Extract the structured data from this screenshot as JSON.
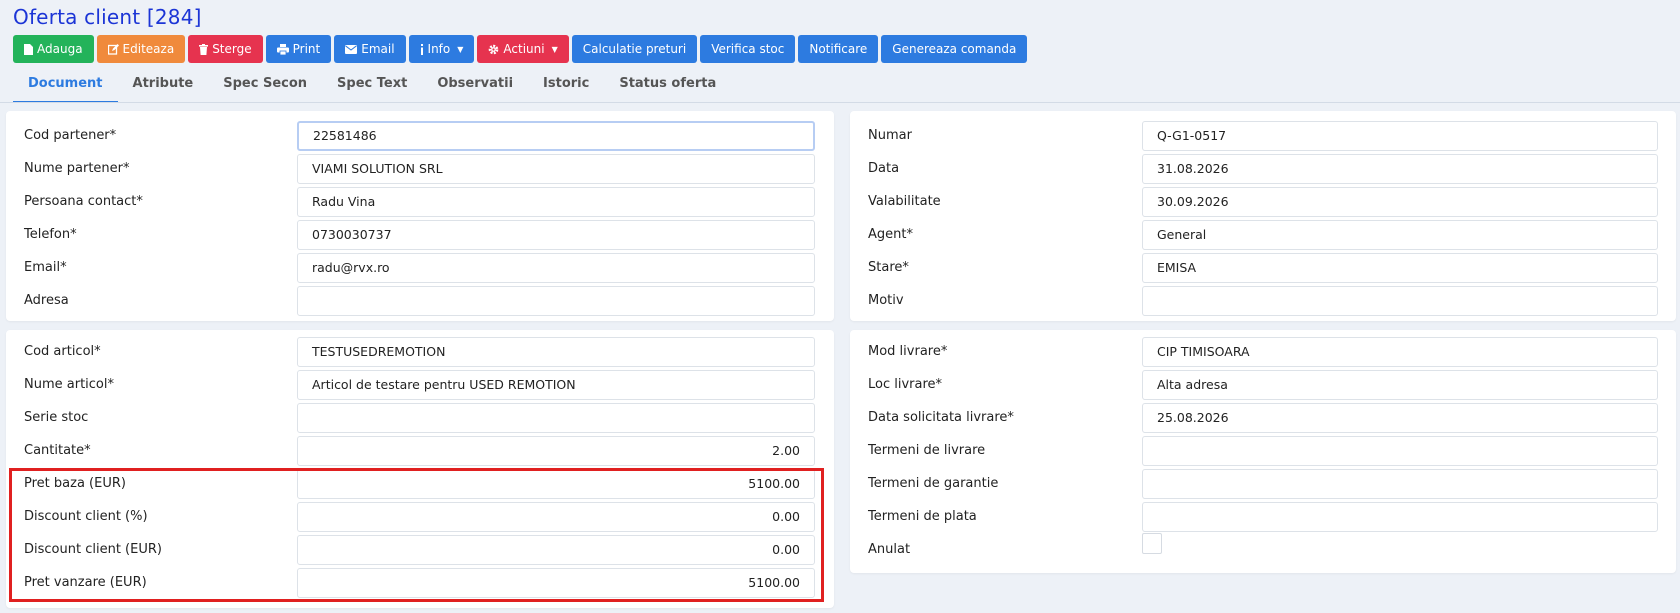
{
  "title": "Oferta client [284]",
  "toolbar": {
    "adauga": "Adauga",
    "editeaza": "Editeaza",
    "sterge": "Sterge",
    "print": "Print",
    "email": "Email",
    "info": "Info",
    "actiuni": "Actiuni",
    "calculatie": "Calculatie preturi",
    "verifica": "Verifica stoc",
    "notificare": "Notificare",
    "genereaza": "Genereaza comanda"
  },
  "tabs": [
    "Document",
    "Atribute",
    "Spec Secon",
    "Spec Text",
    "Observatii",
    "Istoric",
    "Status oferta"
  ],
  "partner": {
    "cod_label": "Cod partener*",
    "cod_value": "22581486",
    "nume_label": "Nume partener*",
    "nume_value": "VIAMI SOLUTION SRL",
    "contact_label": "Persoana contact*",
    "contact_value": "Radu Vina",
    "telefon_label": "Telefon*",
    "telefon_value": "0730030737",
    "email_label": "Email*",
    "email_value": "radu@rvx.ro",
    "adresa_label": "Adresa",
    "adresa_value": ""
  },
  "document": {
    "numar_label": "Numar",
    "numar_value": "Q-G1-0517",
    "data_label": "Data",
    "data_value": "31.08.2026",
    "valab_label": "Valabilitate",
    "valab_value": "30.09.2026",
    "agent_label": "Agent*",
    "agent_value": "General",
    "stare_label": "Stare*",
    "stare_value": "EMISA",
    "motiv_label": "Motiv",
    "motiv_value": ""
  },
  "article": {
    "cod_label": "Cod articol*",
    "cod_value": "TESTUSEDREMOTION",
    "nume_label": "Nume articol*",
    "nume_value": "Articol de testare pentru USED REMOTION",
    "serie_label": "Serie stoc",
    "serie_value": "",
    "cant_label": "Cantitate*",
    "cant_value": "2.00",
    "pret_baza_label": "Pret baza (EUR)",
    "pret_baza_value": "5100.00",
    "disc_pct_label": "Discount client (%)",
    "disc_pct_value": "0.00",
    "disc_eur_label": "Discount client (EUR)",
    "disc_eur_value": "0.00",
    "pret_vanz_label": "Pret vanzare (EUR)",
    "pret_vanz_value": "5100.00"
  },
  "delivery": {
    "mod_label": "Mod livrare*",
    "mod_value": "CIP TIMISOARA",
    "loc_label": "Loc livrare*",
    "loc_value": "Alta adresa",
    "data_label": "Data solicitata livrare*",
    "data_value": "25.08.2026",
    "term_livr_label": "Termeni de livrare",
    "term_livr_value": "",
    "term_gar_label": "Termeni de garantie",
    "term_gar_value": "",
    "term_plata_label": "Termeni de plata",
    "term_plata_value": "",
    "anulat_label": "Anulat"
  },
  "colors": {
    "title": "#1c35d6",
    "green": "#23b35a",
    "orange": "#f08a3c",
    "red": "#e6334f",
    "blue": "#2d7be0",
    "highlight": "#e02020"
  }
}
